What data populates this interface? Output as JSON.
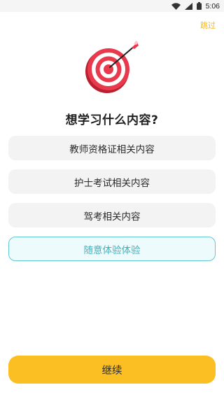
{
  "status_bar": {
    "time": "5:06",
    "icons": [
      "wifi-icon",
      "cellular-signal-icon",
      "battery-icon"
    ]
  },
  "header": {
    "skip_label": "跳过"
  },
  "hero": {
    "icon": "target-dart-icon",
    "colors": {
      "red": "#e8394d",
      "white": "#ffffff"
    }
  },
  "question": {
    "title": "想学习什么内容?"
  },
  "options": [
    {
      "label": "教师资格证相关内容",
      "selected": false
    },
    {
      "label": "护士考试相关内容",
      "selected": false
    },
    {
      "label": "驾考相关内容",
      "selected": false
    },
    {
      "label": "随意体验体验",
      "selected": true
    }
  ],
  "footer": {
    "continue_label": "继续"
  },
  "colors": {
    "accent_yellow": "#fbbf24",
    "skip_yellow": "#f5b820",
    "selected_border": "#63c9d0",
    "selected_text": "#46b1bb",
    "option_bg": "#f3f3f3"
  }
}
